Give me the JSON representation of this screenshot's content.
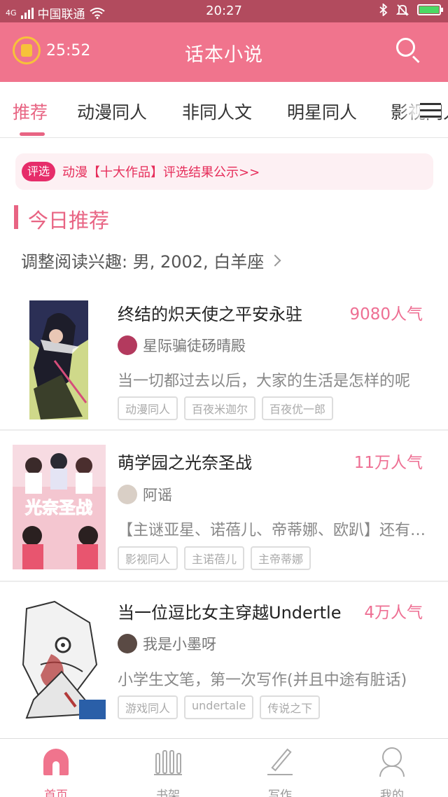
{
  "status_bar": {
    "carrier": "中国联通",
    "network": "4G",
    "time": "20:27"
  },
  "header": {
    "timer": "25:52",
    "title": "话本小说"
  },
  "tabs": [
    {
      "label": "推荐",
      "active": true
    },
    {
      "label": "动漫同人",
      "active": false
    },
    {
      "label": "非同人文",
      "active": false
    },
    {
      "label": "明星同人",
      "active": false
    },
    {
      "label": "影视同人",
      "active": false
    }
  ],
  "announcement": {
    "badge": "评选",
    "text": "动漫【十大作品】评选结果公示>>"
  },
  "section": {
    "title": "今日推荐",
    "interest": "调整阅读兴趣: 男, 2002, 白羊座"
  },
  "books": [
    {
      "title": "终结的炽天使之平安永驻",
      "popularity": "9080人气",
      "author": "星际骗徒砀晴殿",
      "description": "当一切都过去以后，大家的生活是怎样的呢",
      "tags": [
        "动漫同人",
        "百夜米迦尔",
        "百夜优一郎"
      ]
    },
    {
      "title": "萌学园之光奈圣战",
      "popularity": "11万人气",
      "author": "阿谣",
      "description": "【主谜亚星、诺蓓儿、帝蒂娜、欧趴】还有其他人",
      "tags": [
        "影视同人",
        "主诺蓓儿",
        "主帝蒂娜"
      ],
      "cover_text": "光奈圣战"
    },
    {
      "title": "当一位逗比女主穿越Undertle",
      "popularity": "4万人气",
      "author": "我是小墨呀",
      "description": "小学生文笔，第一次写作(并且中途有脏话)",
      "tags": [
        "游戏同人",
        "undertale",
        "传说之下"
      ]
    }
  ],
  "bottom_nav": [
    {
      "label": "首页",
      "icon": "home-icon",
      "active": true
    },
    {
      "label": "书架",
      "icon": "bookshelf-icon",
      "active": false
    },
    {
      "label": "写作",
      "icon": "pencil-icon",
      "active": false
    },
    {
      "label": "我的",
      "icon": "profile-icon",
      "active": false
    }
  ],
  "colors": {
    "accent": "#f0748d",
    "status_bar": "#b24b5e",
    "popularity": "#ee6f93",
    "badge": "#e62d6a"
  }
}
